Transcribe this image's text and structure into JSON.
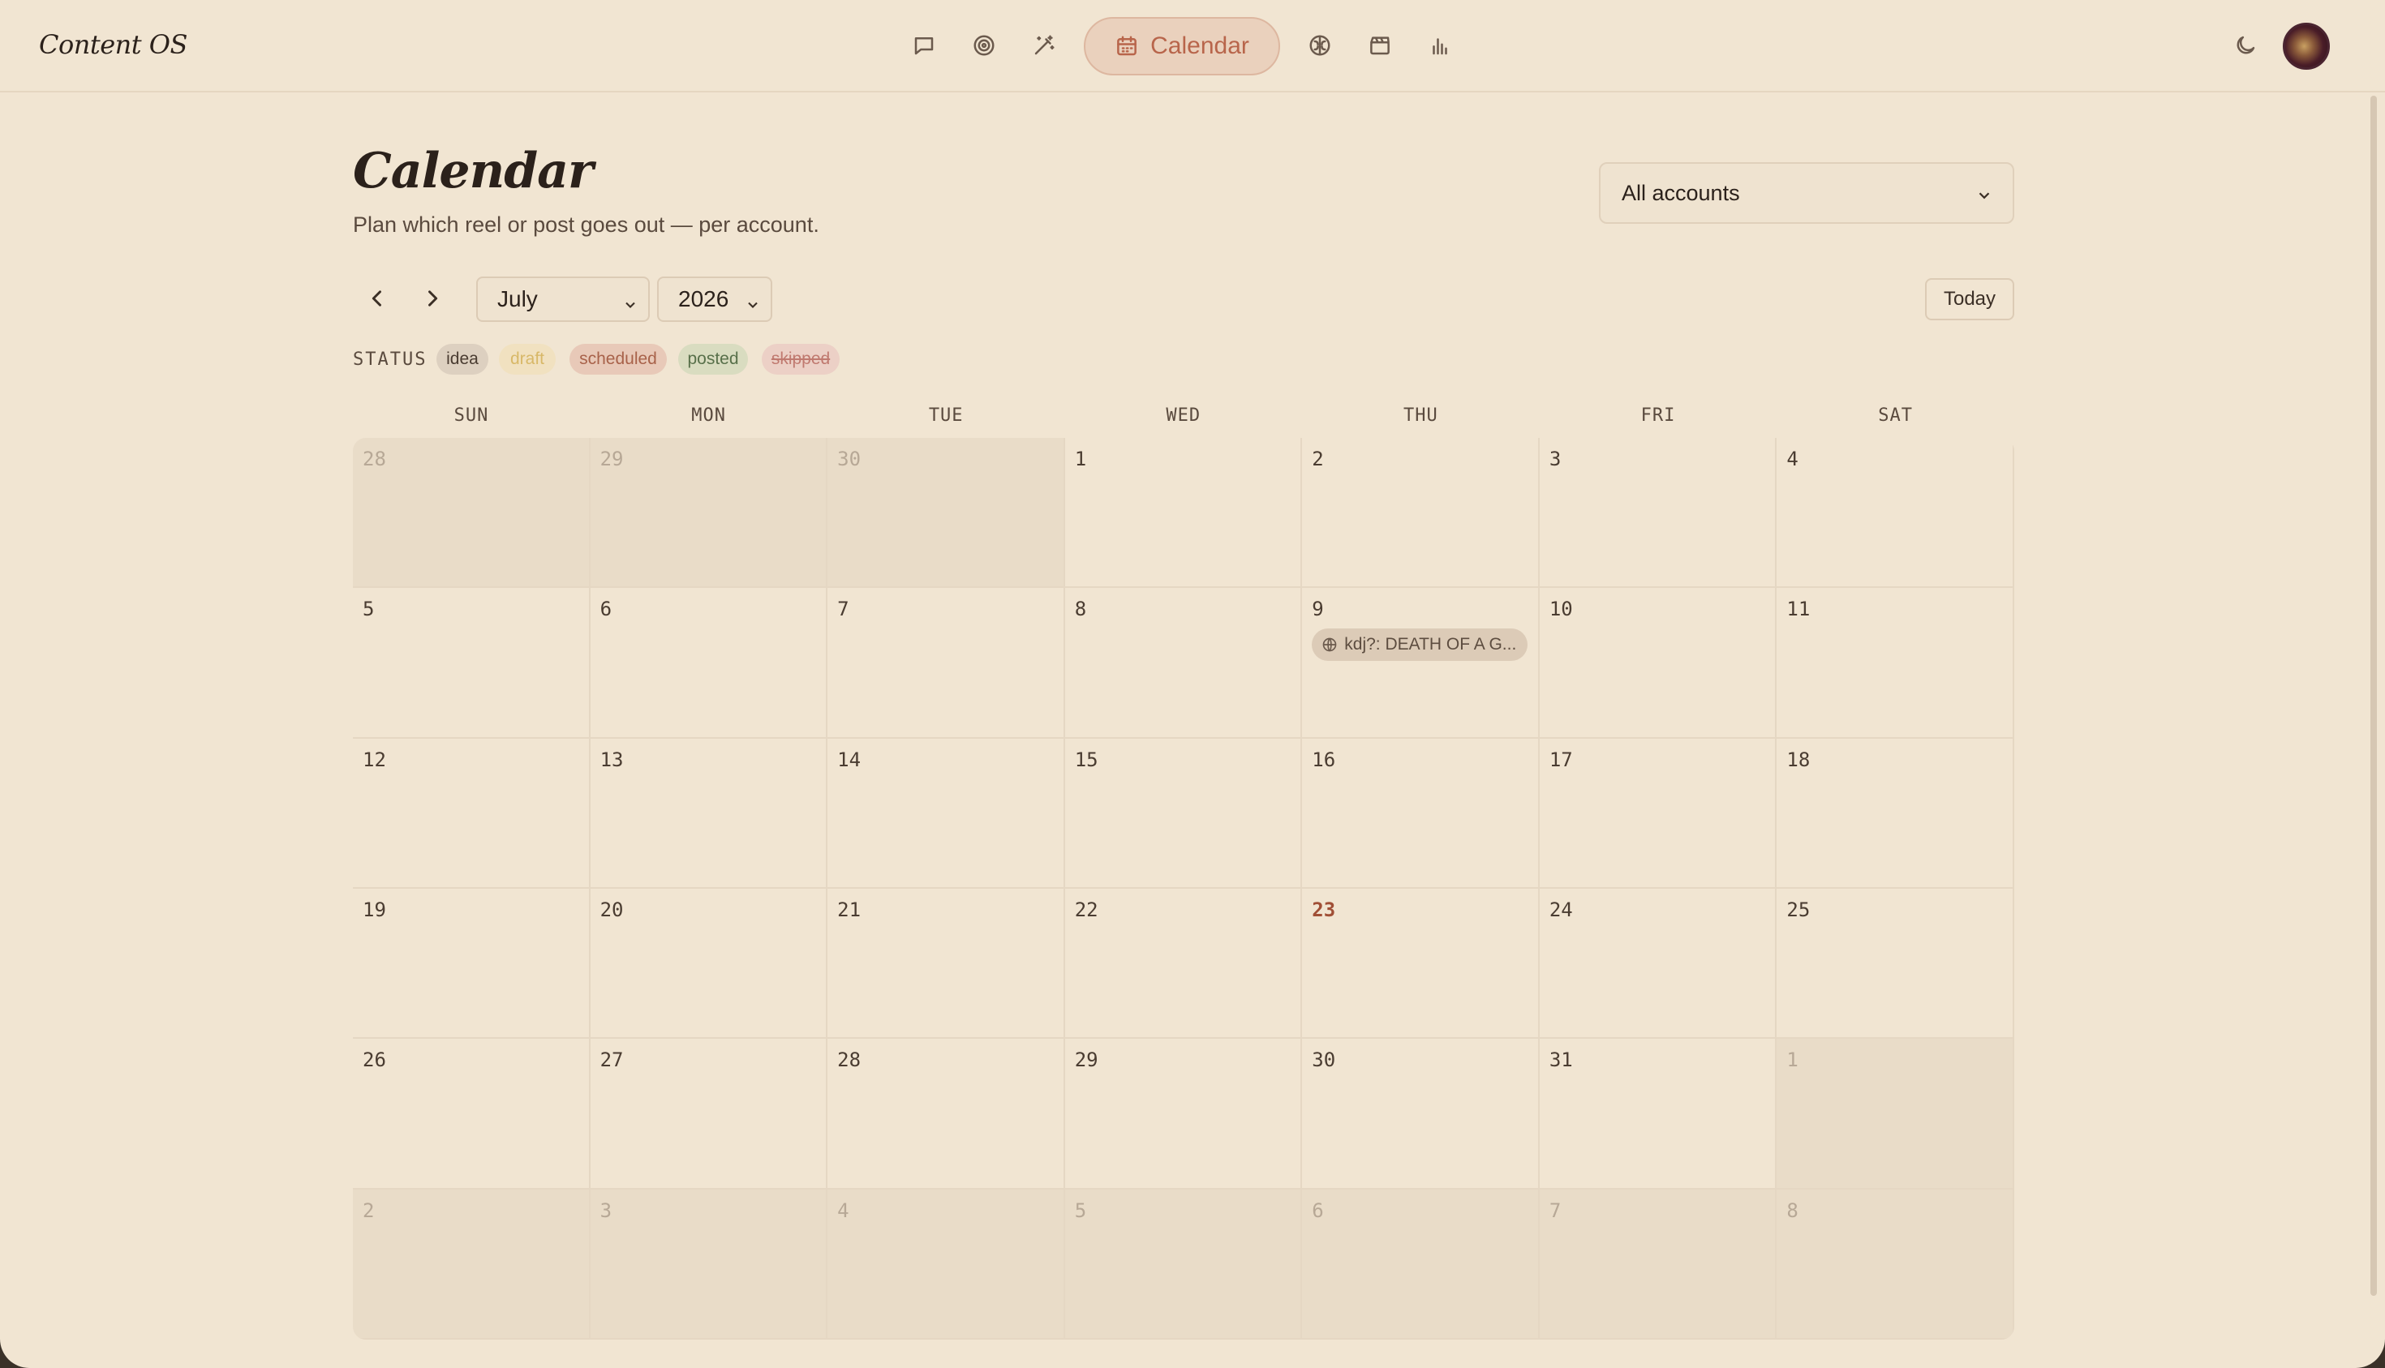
{
  "app": {
    "brand": "Content OS"
  },
  "nav": {
    "items": [
      {
        "name": "chat-icon"
      },
      {
        "name": "target-icon"
      },
      {
        "name": "magic-wand-icon"
      },
      {
        "name": "calendar-icon",
        "label": "Calendar",
        "active": true
      },
      {
        "name": "brain-icon"
      },
      {
        "name": "clapperboard-icon"
      },
      {
        "name": "bar-chart-icon"
      }
    ],
    "theme_icon": "moon-icon"
  },
  "header": {
    "title": "Calendar",
    "subtitle": "Plan which reel or post goes out — per account.",
    "account_filter": "All accounts"
  },
  "controls": {
    "month": "July",
    "year": "2026",
    "today_label": "Today"
  },
  "status": {
    "label": "STATUS",
    "chips": [
      {
        "label": "idea",
        "color": "#ddd0c0",
        "text": "#4a3c31"
      },
      {
        "label": "draft",
        "color": "#f1e1c0",
        "text": "#d8b868"
      },
      {
        "label": "scheduled",
        "color": "#e8c9b8",
        "text": "#a8624a"
      },
      {
        "label": "posted",
        "color": "#d9dcc0",
        "text": "#58704a"
      },
      {
        "label": "skipped",
        "color": "#ecd0c6",
        "text": "#c07a70",
        "strike": true
      }
    ]
  },
  "calendar": {
    "weekdays": [
      "SUN",
      "MON",
      "TUE",
      "WED",
      "THU",
      "FRI",
      "SAT"
    ],
    "today": "23",
    "weeks": [
      [
        "28",
        "29",
        "30",
        "1",
        "2",
        "3",
        "4"
      ],
      [
        "5",
        "6",
        "7",
        "8",
        "9",
        "10",
        "11"
      ],
      [
        "12",
        "13",
        "14",
        "15",
        "16",
        "17",
        "18"
      ],
      [
        "19",
        "20",
        "21",
        "22",
        "23",
        "24",
        "25"
      ],
      [
        "26",
        "27",
        "28",
        "29",
        "30",
        "31",
        "1"
      ],
      [
        "2",
        "3",
        "4",
        "5",
        "6",
        "7",
        "8"
      ]
    ],
    "events": [
      {
        "day": "9",
        "title": "kdj?: DEATH OF A G...",
        "icon": "globe-icon"
      }
    ]
  }
}
